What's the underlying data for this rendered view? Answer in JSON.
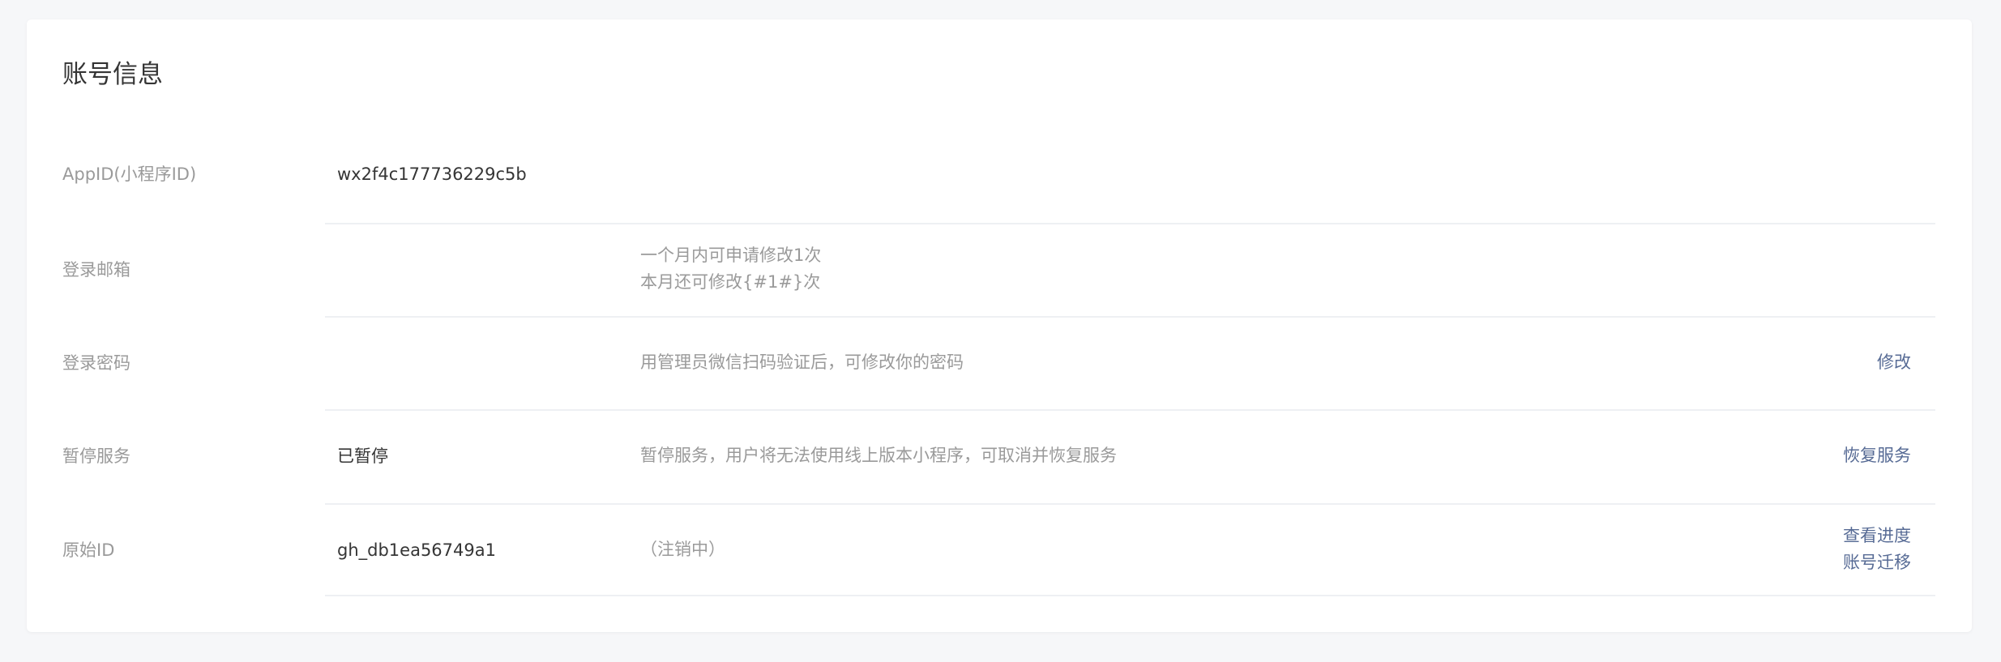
{
  "section": {
    "title": "账号信息"
  },
  "rows": {
    "appid": {
      "label": "AppID(小程序ID)",
      "value": "wx2f4c177736229c5b"
    },
    "email": {
      "label": "登录邮箱",
      "desc_line1": "一个月内可申请修改1次",
      "desc_line2": "本月还可修改{#1#}次"
    },
    "password": {
      "label": "登录密码",
      "desc": "用管理员微信扫码验证后，可修改你的密码",
      "action": "修改"
    },
    "pause": {
      "label": "暂停服务",
      "value": "已暂停",
      "desc": "暂停服务，用户将无法使用线上版本小程序，可取消并恢复服务",
      "action": "恢复服务"
    },
    "origin": {
      "label": "原始ID",
      "value": "gh_db1ea56749a1",
      "desc": "（注销中）",
      "action_progress": "查看进度",
      "action_migrate": "账号迁移"
    }
  },
  "colors": {
    "link": "#576b95",
    "label": "#9a9a9a",
    "text": "#353535",
    "background": "#f6f7f9",
    "card": "#ffffff"
  }
}
